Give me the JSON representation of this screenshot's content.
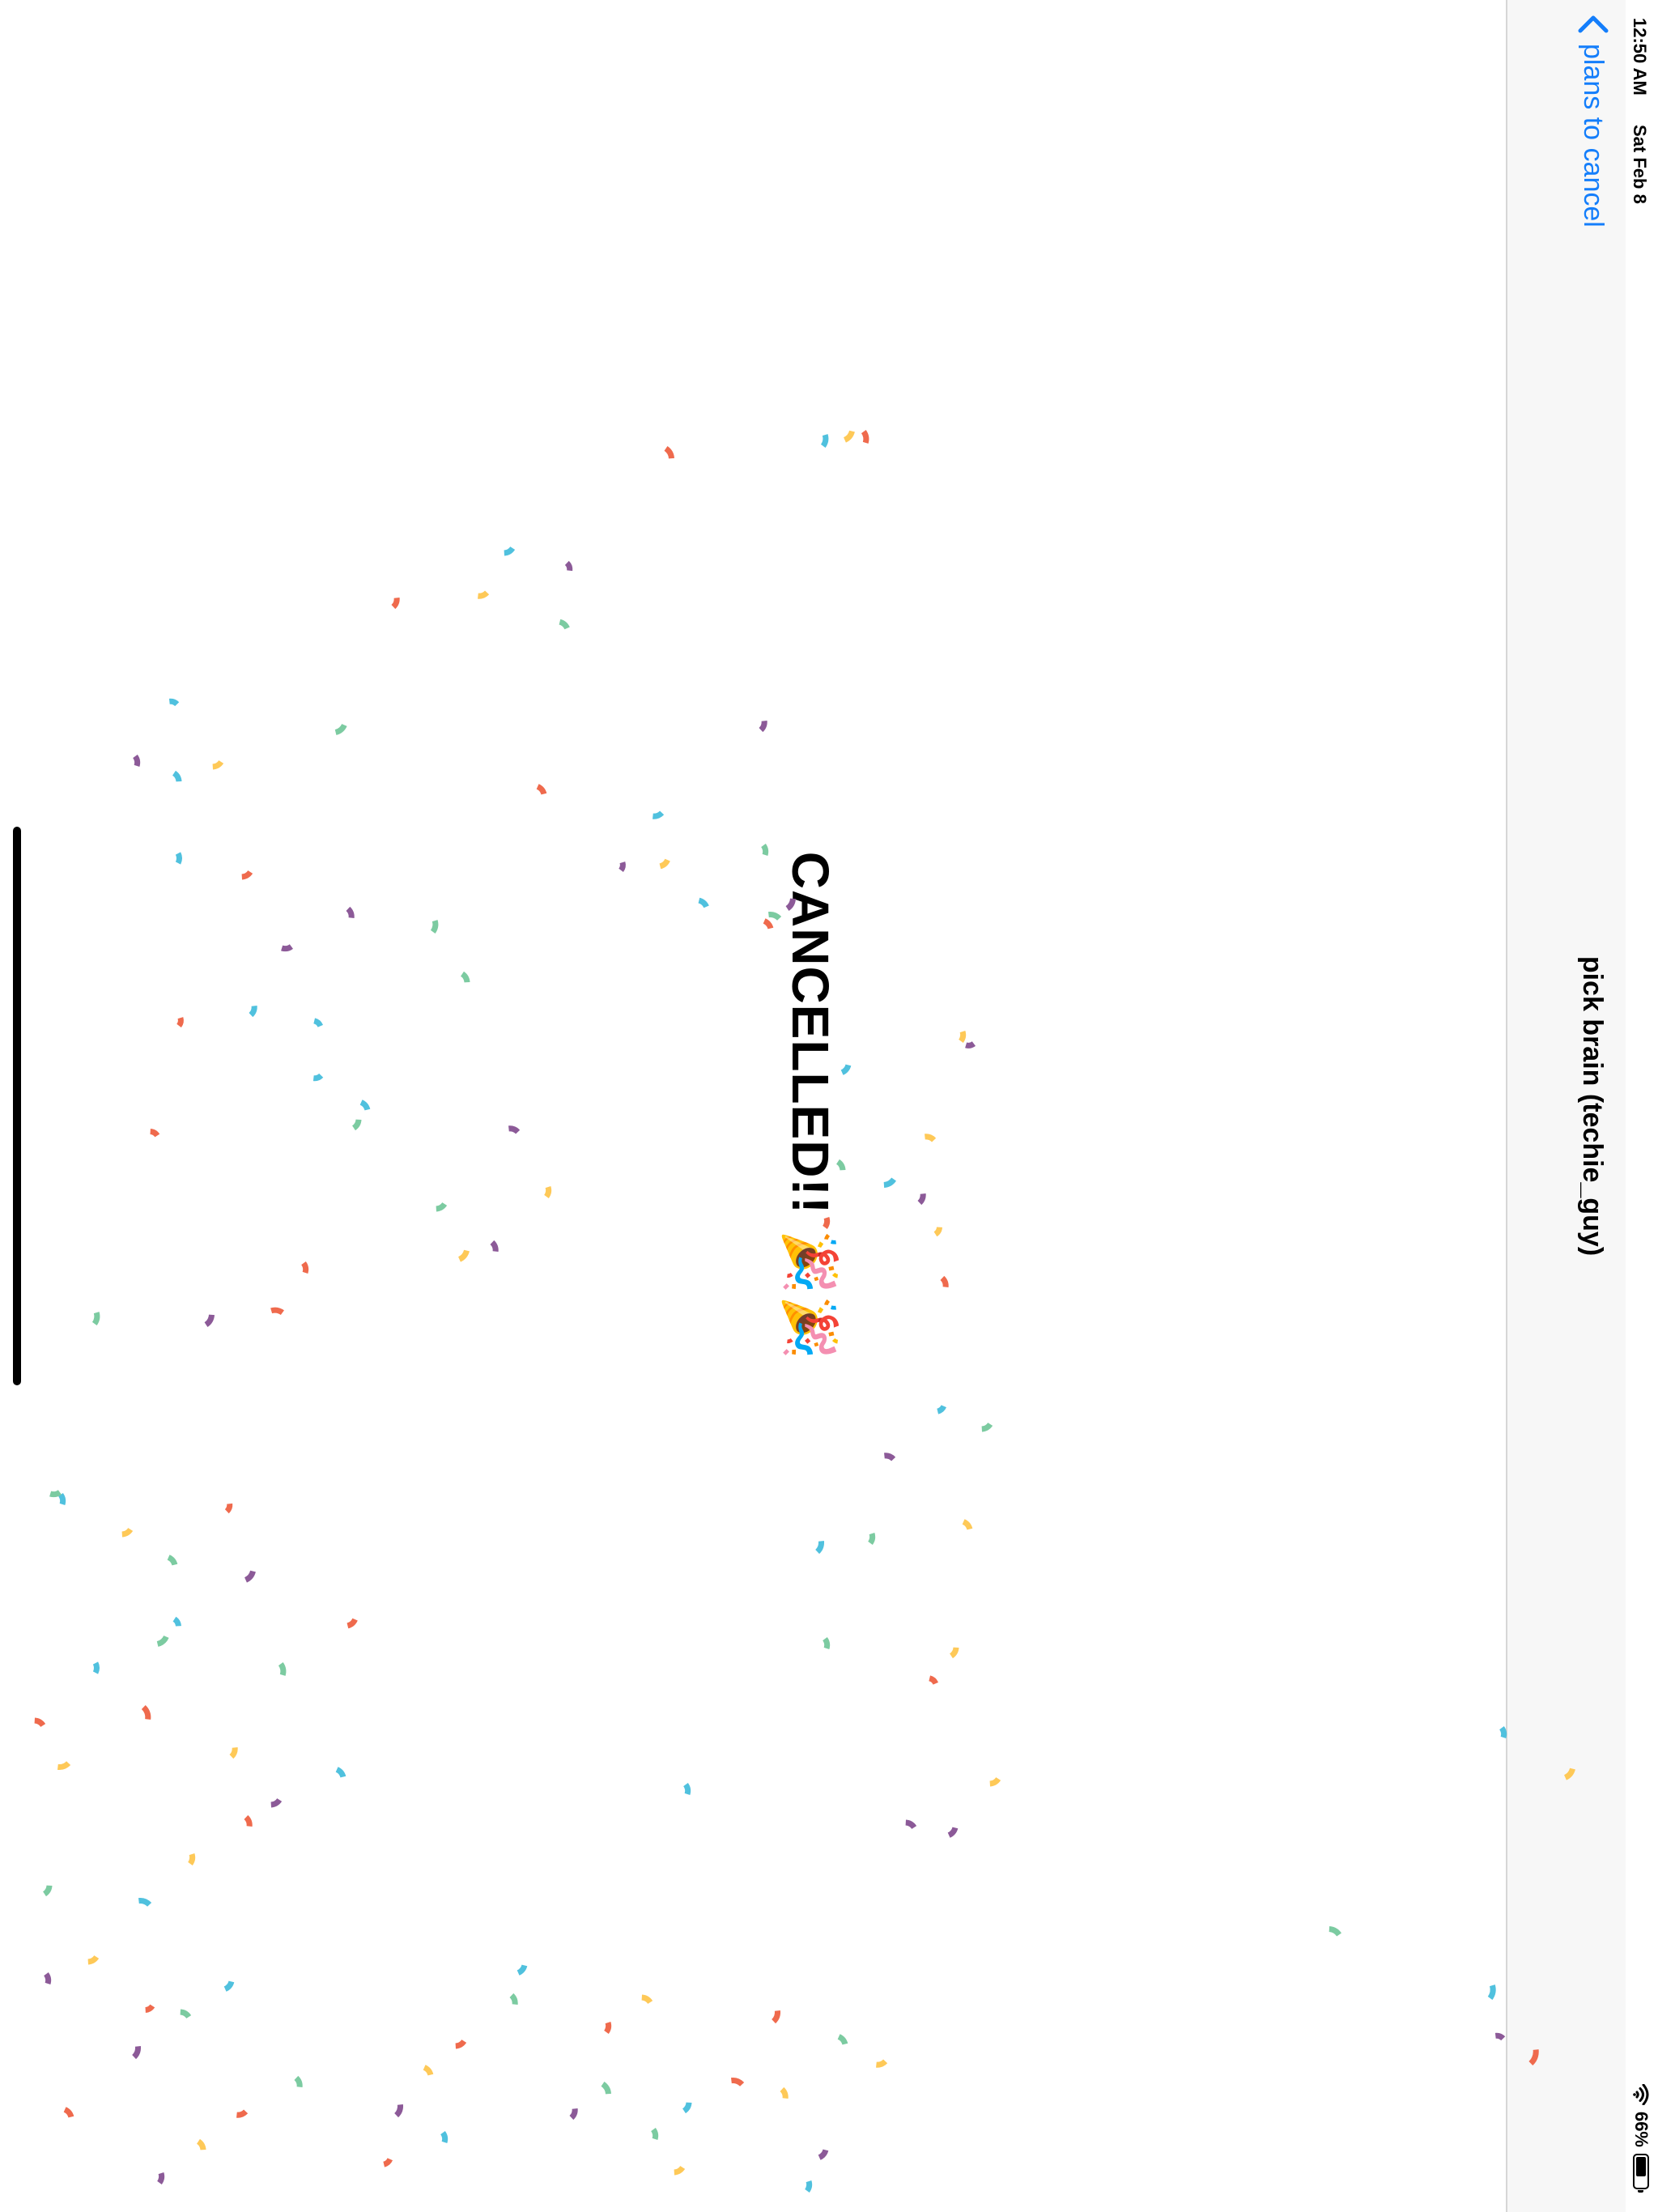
{
  "status_bar": {
    "time": "12:50 AM",
    "date": "Sat Feb 8",
    "battery_text": "66%",
    "battery_level": 0.66,
    "wifi": "wifi-icon"
  },
  "nav": {
    "back_label": "plans to cancel",
    "back_icon": "chevron-left-icon",
    "title": "pick brain (techie_guy)",
    "accent_color": "#147efb"
  },
  "content": {
    "message": "CANCELLED!! 🎉🎉"
  },
  "confetti": {
    "colors": [
      "#ef6a4d",
      "#fec958",
      "#7ccba1",
      "#50c1de",
      "#8c5a98"
    ]
  }
}
